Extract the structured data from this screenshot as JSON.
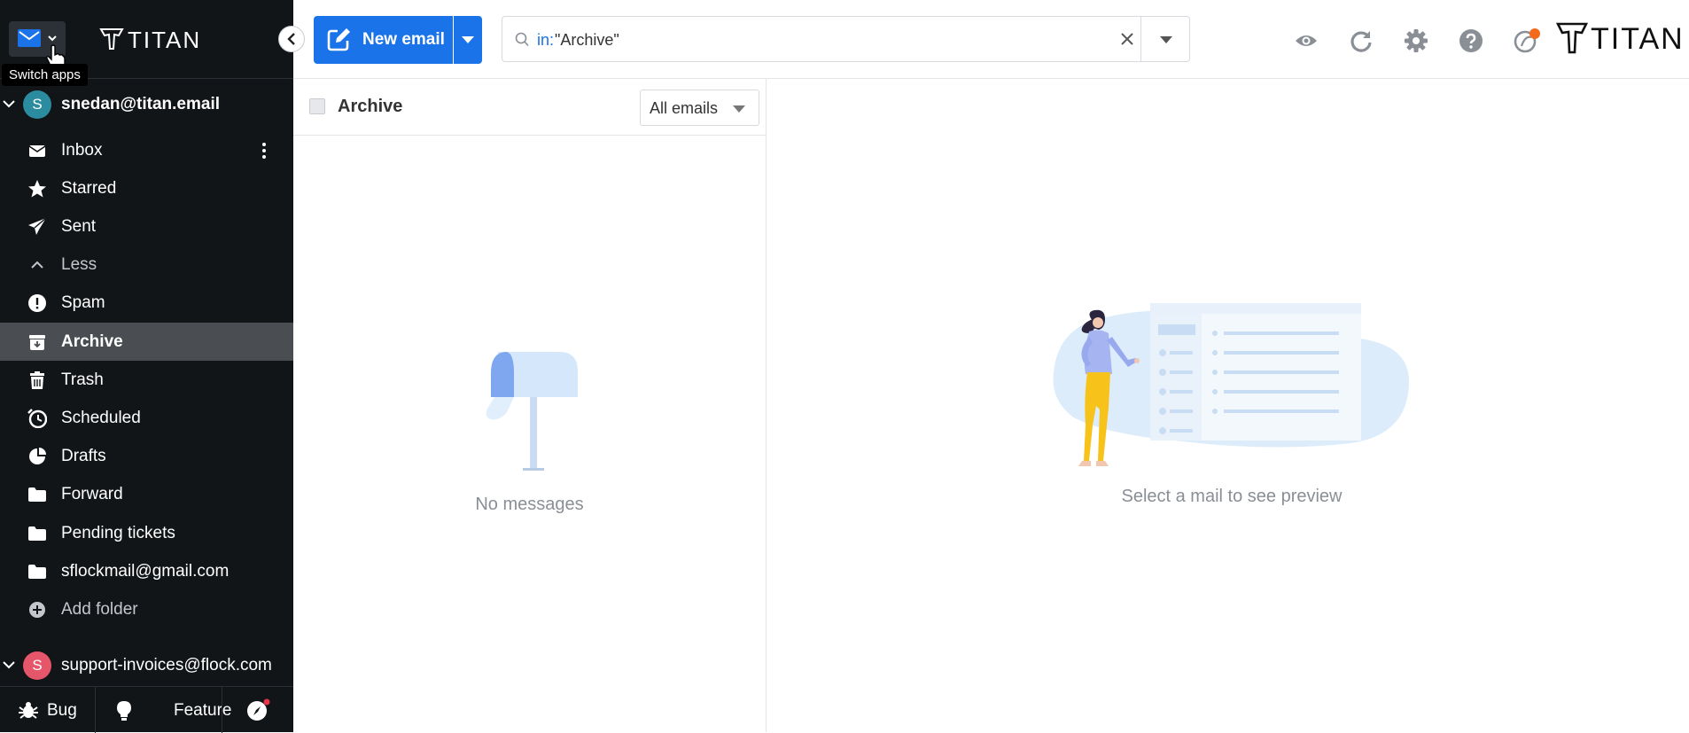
{
  "app": {
    "brand": "TITAN",
    "switch_apps_tooltip": "Switch apps"
  },
  "accounts": [
    {
      "avatar_letter": "S",
      "email": "snedan@titan.email",
      "color": "#2a8c9e"
    },
    {
      "avatar_letter": "S",
      "email": "support-invoices@flock.com",
      "color": "#e5566a"
    }
  ],
  "sidebar": {
    "items": [
      {
        "label": "Inbox",
        "icon": "envelope-icon"
      },
      {
        "label": "Starred",
        "icon": "star-icon"
      },
      {
        "label": "Sent",
        "icon": "paper-plane-icon"
      },
      {
        "label": "Less",
        "icon": "chevron-up-icon"
      },
      {
        "label": "Spam",
        "icon": "exclamation-icon"
      },
      {
        "label": "Archive",
        "icon": "archive-icon",
        "active": true
      },
      {
        "label": "Trash",
        "icon": "trash-icon"
      },
      {
        "label": "Scheduled",
        "icon": "clock-icon"
      },
      {
        "label": "Drafts",
        "icon": "draft-icon"
      },
      {
        "label": "Forward",
        "icon": "folder-icon"
      },
      {
        "label": "Pending tickets",
        "icon": "folder-icon"
      },
      {
        "label": "sflockmail@gmail.com",
        "icon": "folder-icon"
      },
      {
        "label": "Add folder",
        "icon": "plus-circle-icon"
      }
    ],
    "bottom": {
      "bug_label": "Bug",
      "feature_label": "Feature"
    }
  },
  "toolbar": {
    "new_email_label": "New email",
    "search_prefix": "in:",
    "search_value": "\"Archive\""
  },
  "list": {
    "folder_title": "Archive",
    "filter_selected": "All emails",
    "empty_text": "No messages"
  },
  "preview": {
    "empty_text": "Select a mail to see preview"
  },
  "colors": {
    "accent": "#1a73e8",
    "sidebar_bg": "#121518",
    "active_item_bg": "#4a4d51",
    "notification_dot": "#f36a1d"
  }
}
